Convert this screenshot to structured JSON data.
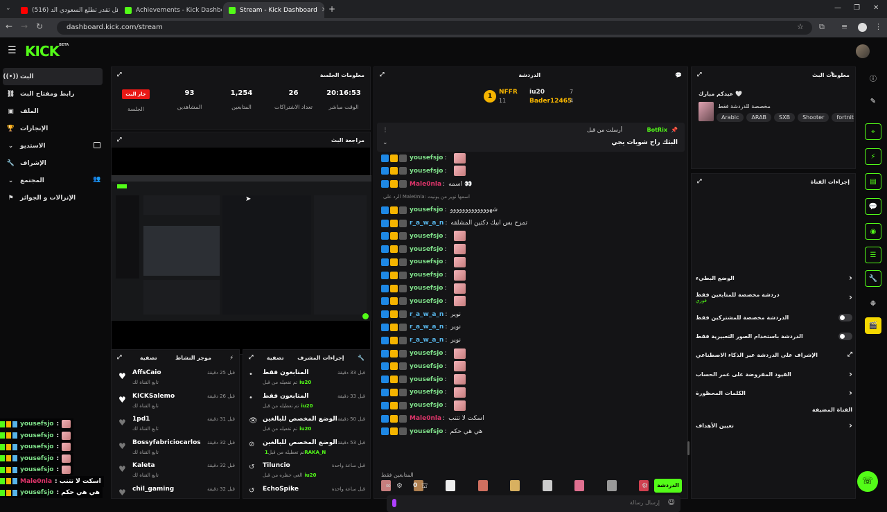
{
  "browser": {
    "tabs": [
      {
        "title": "(516) هل تقدر تطلع السعودي الد..."
      },
      {
        "title": "Achievements - Kick Dashboard"
      },
      {
        "title": "Stream - Kick Dashboard"
      }
    ],
    "url": "dashboard.kick.com/stream"
  },
  "brand": {
    "logo": "KICK",
    "beta": "BETA",
    "accent": "#53fc18"
  },
  "sidebar": {
    "items": [
      {
        "label": "البث",
        "icon": "live-icon"
      },
      {
        "label": "رابط ومفتاح البث",
        "icon": "link-icon"
      },
      {
        "label": "الملف",
        "icon": "profile-icon"
      },
      {
        "label": "الإنجازات",
        "icon": "trophy-icon"
      },
      {
        "label": "الاستديو",
        "icon": "studio-icon"
      },
      {
        "label": "الإشراف",
        "icon": "wrench-icon"
      },
      {
        "label": "المجتمع",
        "icon": "community-icon"
      },
      {
        "label": "الإنزالات و الجوائز",
        "icon": "drops-icon"
      }
    ]
  },
  "session": {
    "title": "معلومات الجلسة",
    "live_badge": "جار البث",
    "stats": [
      {
        "value": "20:16:53",
        "label": "الوقت مباشر"
      },
      {
        "value": "26",
        "label": "تعداد الاشتراكات"
      },
      {
        "value": "1,254",
        "label": "المتابعين"
      },
      {
        "value": "93",
        "label": "المشاهدين"
      },
      {
        "value": "",
        "label": "الجلسة"
      }
    ]
  },
  "preview": {
    "title": "مراجعة البث"
  },
  "activity": {
    "title": "موجز النشاط",
    "filter": "تصفية",
    "items": [
      {
        "name": "AffsCaio",
        "sub": "تابع القناة لك",
        "time": "قبل 25 دقيقة"
      },
      {
        "name": "KICKSalemo",
        "sub": "تابع القناة لك",
        "time": "قبل 26 دقيقة"
      },
      {
        "name": "1pd1",
        "sub": "تابع القناة لك",
        "time": "قبل 31 دقيقة"
      },
      {
        "name": "Bossyfabriciocarlos",
        "sub": "تابع القناة لك",
        "time": "قبل 32 دقيقة"
      },
      {
        "name": "Kaleta",
        "sub": "تابع القناة لك",
        "time": "قبل 32 دقيقة"
      },
      {
        "name": "chil_gaming",
        "sub": "",
        "time": "قبل 32 دقيقة"
      }
    ]
  },
  "modactions": {
    "title": "إجراءات المشرف",
    "filter": "تصفية",
    "items": [
      {
        "name": "المتابعون فقط",
        "sub": "تم تفعيله من قبل",
        "who": "iu20",
        "time": "قبل 33 دقيقة"
      },
      {
        "name": "المتابعون فقط",
        "sub": "تم تعطيله من قبل",
        "who": "iu20",
        "time": "قبل 33 دقيقة"
      },
      {
        "name": "الوضع المخصص للبالغين",
        "sub": "تم تفعيله من قبل",
        "who": "iu20",
        "time": "قبل 50 دقيقة"
      },
      {
        "name": "الوضع المخصص للبالغين",
        "sub": "تم تعطيله من قبل",
        "who": "1RAKA_N",
        "time": "قبل 53 دقيقة"
      },
      {
        "name": "Tiluncio",
        "sub": "الغي حظره من قبل",
        "who": "iu20",
        "time": "قبل ساعة واحدة"
      },
      {
        "name": "EchoSpike",
        "sub": "",
        "who": "",
        "time": "قبل ساعة واحدة"
      }
    ]
  },
  "chat": {
    "title": "الدردشة",
    "leaderboard": {
      "first": {
        "name": "NFFR",
        "count": "11"
      },
      "second": {
        "name": "iu20",
        "count": "7"
      },
      "third": {
        "name": "Bader12465",
        "count": "4"
      }
    },
    "pinned": {
      "by": "أرسلت من قبل",
      "user": "BotRix",
      "text": "البثك راح شويات يجي"
    },
    "messages": [
      {
        "user": "yousefsjo",
        "color": "#7fe08a",
        "text": "",
        "emote": true
      },
      {
        "user": "yousefsjo",
        "color": "#7fe08a",
        "text": "",
        "emote": true
      },
      {
        "user": "Male0nla",
        "color": "#e0356b",
        "text": "اسمه 👀",
        "emote": false
      },
      {
        "user": "",
        "color": "#888",
        "text": "الرد على Male0nla: اسمها نوير من يونيت",
        "emote": false
      },
      {
        "user": "yousefsjo",
        "color": "#7fe08a",
        "text": "شهووووووووووووو",
        "emote": false
      },
      {
        "user": "r_a_w_a_n",
        "color": "#57b4e8",
        "text": "تمزح بس ابيك دكتين المشلقه",
        "emote": false
      },
      {
        "user": "yousefsjo",
        "color": "#7fe08a",
        "text": "",
        "emote": true
      },
      {
        "user": "yousefsjo",
        "color": "#7fe08a",
        "text": "",
        "emote": true
      },
      {
        "user": "yousefsjo",
        "color": "#7fe08a",
        "text": "",
        "emote": true
      },
      {
        "user": "yousefsjo",
        "color": "#7fe08a",
        "text": "",
        "emote": true
      },
      {
        "user": "yousefsjo",
        "color": "#7fe08a",
        "text": "",
        "emote": true
      },
      {
        "user": "yousefsjo",
        "color": "#7fe08a",
        "text": "",
        "emote": true
      },
      {
        "user": "r_a_w_a_n",
        "color": "#57b4e8",
        "text": "نوير",
        "emote": false
      },
      {
        "user": "r_a_w_a_n",
        "color": "#57b4e8",
        "text": "نوير",
        "emote": false
      },
      {
        "user": "r_a_w_a_n",
        "color": "#57b4e8",
        "text": "نوير",
        "emote": false
      },
      {
        "user": "yousefsjo",
        "color": "#7fe08a",
        "text": "",
        "emote": true
      },
      {
        "user": "yousefsjo",
        "color": "#7fe08a",
        "text": "",
        "emote": true
      },
      {
        "user": "yousefsjo",
        "color": "#7fe08a",
        "text": "",
        "emote": true
      },
      {
        "user": "yousefsjo",
        "color": "#7fe08a",
        "text": "",
        "emote": true
      },
      {
        "user": "yousefsjo",
        "color": "#7fe08a",
        "text": "",
        "emote": true
      },
      {
        "user": "Male0nla",
        "color": "#e0356b",
        "text": "اسكت لا تتنب",
        "emote": false
      },
      {
        "user": "yousefsjo",
        "color": "#7fe08a",
        "text": "هي هي حكم",
        "emote": false
      }
    ],
    "followers_label": "المتابعين فقط",
    "input_placeholder": "إرسال رسالة",
    "send_label": "الدردشة",
    "count": "0"
  },
  "streaminfo": {
    "title": "معلومات البث",
    "stream_title": "عيدكم مبارك 🤍",
    "category": "مخصصة للدردشة فقط",
    "tags": [
      "Arabic",
      "ARAB",
      "SXB",
      "Shooter",
      "fortnite"
    ]
  },
  "channel_actions": {
    "title": "إجراءات القناة",
    "rows": [
      {
        "label": "الوضع البطيء",
        "control": "chevron"
      },
      {
        "label": "دردشة مخصصة للمتابعين فقط",
        "sub": "فوري",
        "control": "chevron"
      },
      {
        "label": "الدردشة مخصصة للمشتركين فقط",
        "control": "toggle"
      },
      {
        "label": "الدردشة باستخدام الصور التعبيرية فقط",
        "control": "toggle"
      },
      {
        "label": "الإشراف على الدردشة عبر الذكاء الاصطناعي",
        "control": "external"
      },
      {
        "label": "القيود المفروضة على عمر الحساب",
        "control": "chevron"
      },
      {
        "label": "الكلمات المحظورة",
        "control": "chevron"
      },
      {
        "label": "القناة المضيفة",
        "control": "none"
      },
      {
        "label": "تعيين الأهداف",
        "control": "chevron"
      }
    ]
  },
  "overlay_chat": [
    {
      "user": "yousefsjo",
      "text": ":",
      "emote": true,
      "color": "#7fe08a"
    },
    {
      "user": "yousefsjo",
      "text": ":",
      "emote": true,
      "color": "#7fe08a"
    },
    {
      "user": "yousefsjo",
      "text": ":",
      "emote": true,
      "color": "#7fe08a"
    },
    {
      "user": "yousefsjo",
      "text": ":",
      "emote": true,
      "color": "#7fe08a"
    },
    {
      "user": "yousefsjo",
      "text": ":",
      "emote": true,
      "color": "#7fe08a"
    },
    {
      "user": "Male0nla",
      "text": ": اسكت لا تتنب",
      "emote": false,
      "color": "#e0356b"
    },
    {
      "user": "yousefsjo",
      "text": ": هي هي حكم",
      "emote": false,
      "color": "#7fe08a"
    }
  ]
}
